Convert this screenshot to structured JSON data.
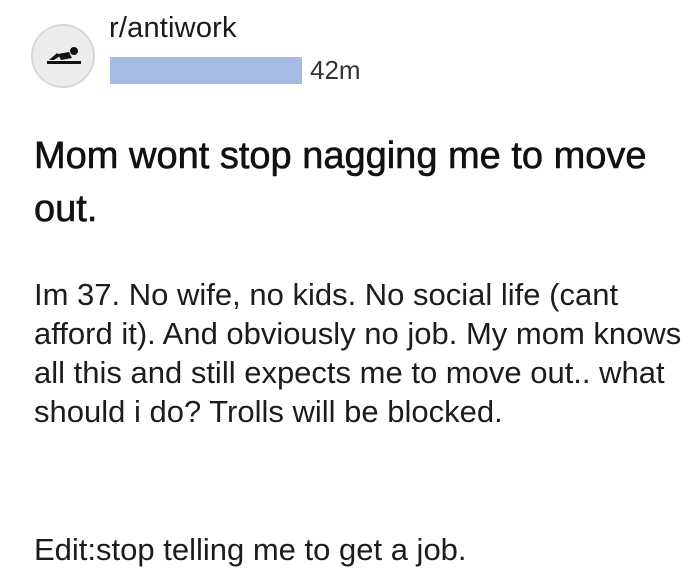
{
  "post": {
    "subreddit": "r/antiwork",
    "age": "42m",
    "avatar_icon": "reclining-figure-icon",
    "redaction_color": "#a4bce3",
    "title": "Mom wont stop nagging me to move out.",
    "body": "Im 37. No wife, no kids. No social life (cant afford it). And obviously no job. My mom knows all this and still expects me to move out.. what should i do? Trolls will be blocked.",
    "edit": "Edit:stop telling me to get a job."
  }
}
